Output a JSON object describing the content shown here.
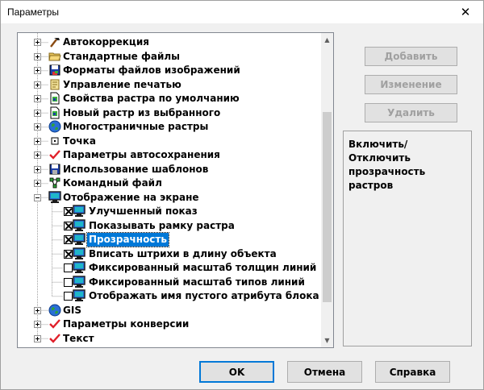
{
  "window": {
    "title": "Параметры",
    "close_glyph": "✕"
  },
  "tree": {
    "items": [
      {
        "label": "Автокоррекция",
        "icon": "hammer-icon",
        "expander": "plus"
      },
      {
        "label": "Стандартные файлы",
        "icon": "folder-icon",
        "expander": "plus"
      },
      {
        "label": "Форматы файлов изображений",
        "icon": "disk-image-icon",
        "expander": "plus"
      },
      {
        "label": "Управление печатью",
        "icon": "scroll-icon",
        "expander": "plus"
      },
      {
        "label": "Свойства растра по умолчанию",
        "icon": "document-icon",
        "expander": "plus"
      },
      {
        "label": "Новый растр из выбранного",
        "icon": "document-icon",
        "expander": "plus"
      },
      {
        "label": "Многостраничные растры",
        "icon": "globe-icon",
        "expander": "plus"
      },
      {
        "label": "Точка",
        "icon": "point-icon",
        "expander": "plus"
      },
      {
        "label": "Параметры автосохранения",
        "icon": "red-check-icon",
        "expander": "plus"
      },
      {
        "label": "Использование шаблонов",
        "icon": "disk-icon",
        "expander": "plus"
      },
      {
        "label": "Командный файл",
        "icon": "network-icon",
        "expander": "plus"
      },
      {
        "label": "Отображение на экране",
        "icon": "monitor-icon",
        "expander": "minus"
      },
      {
        "label": "Улучшенный показ",
        "icon": "monitor-icon",
        "checked": true,
        "child": true
      },
      {
        "label": "Показывать рамку растра",
        "icon": "monitor-icon",
        "checked": true,
        "child": true
      },
      {
        "label": "Прозрачность",
        "icon": "monitor-icon",
        "checked": true,
        "child": true,
        "selected": true
      },
      {
        "label": "Вписать штрихи в длину объекта",
        "icon": "monitor-icon",
        "checked": true,
        "child": true
      },
      {
        "label": "Фиксированный масштаб толщин линий",
        "icon": "monitor-icon",
        "checked": false,
        "child": true
      },
      {
        "label": "Фиксированный масштаб типов линий",
        "icon": "monitor-icon",
        "checked": false,
        "child": true
      },
      {
        "label": "Отображать имя пустого атрибута блока",
        "icon": "monitor-icon",
        "checked": false,
        "child": true
      },
      {
        "label": "GIS",
        "icon": "globe-icon",
        "expander": "plus"
      },
      {
        "label": "Параметры конверсии",
        "icon": "red-check-icon",
        "expander": "plus"
      },
      {
        "label": "Текст",
        "icon": "red-check-icon",
        "expander": "plus"
      }
    ]
  },
  "side_buttons": {
    "add": "Добавить",
    "edit": "Изменение",
    "delete": "Удалить"
  },
  "description": {
    "text": "Включить/Отключить прозрачность растров"
  },
  "footer": {
    "ok": "OK",
    "cancel": "Отмена",
    "help": "Справка"
  },
  "scrollbar": {
    "up_glyph": "▲",
    "down_glyph": "▼"
  },
  "colors": {
    "selection": "#0078d7",
    "check_red": "#e0202a"
  }
}
